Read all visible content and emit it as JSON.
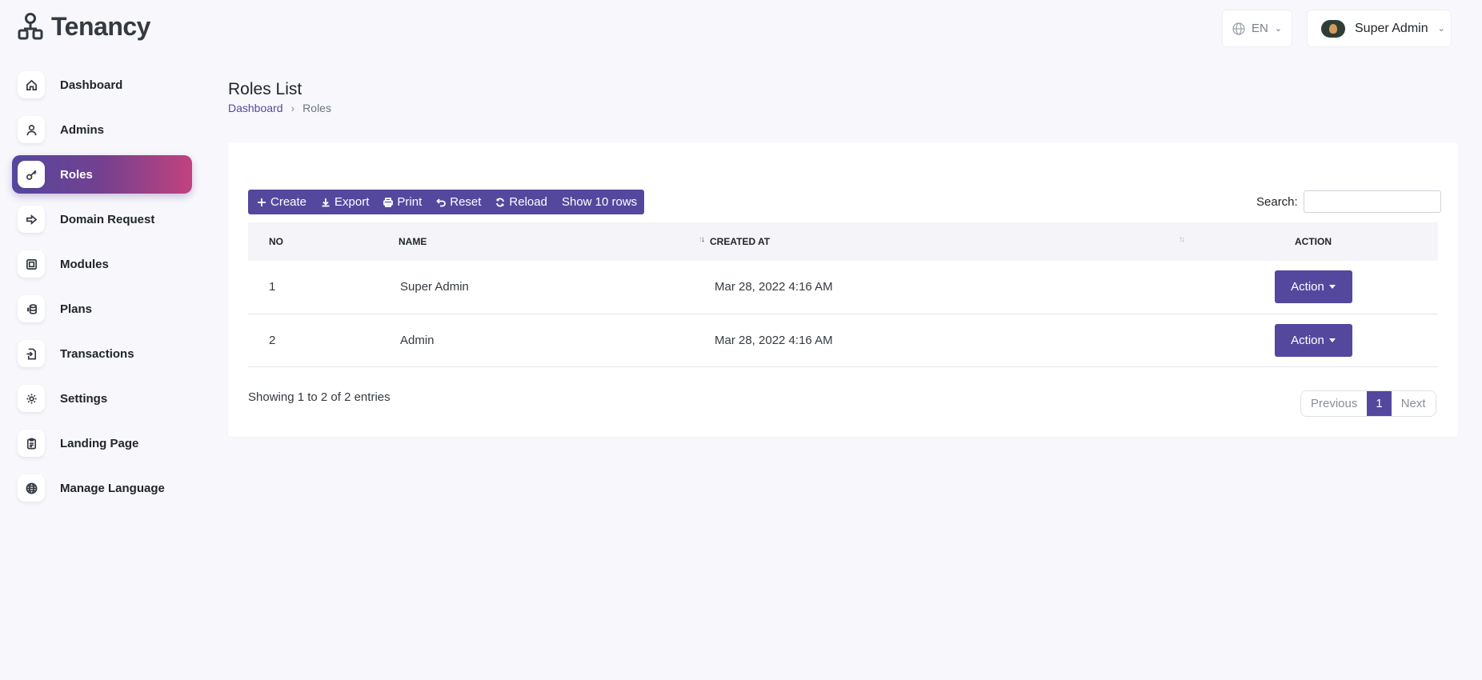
{
  "app": {
    "name": "Tenancy"
  },
  "header": {
    "language": "EN",
    "user_name": "Super Admin"
  },
  "sidebar": {
    "items": [
      {
        "label": "Dashboard",
        "icon": "home-icon"
      },
      {
        "label": "Admins",
        "icon": "user-icon"
      },
      {
        "label": "Roles",
        "icon": "key-icon",
        "active": true
      },
      {
        "label": "Domain Request",
        "icon": "arrow-right-icon"
      },
      {
        "label": "Modules",
        "icon": "cpu-icon"
      },
      {
        "label": "Plans",
        "icon": "coins-icon"
      },
      {
        "label": "Transactions",
        "icon": "file-transfer-icon"
      },
      {
        "label": "Settings",
        "icon": "gear-icon"
      },
      {
        "label": "Landing Page",
        "icon": "clipboard-icon"
      },
      {
        "label": "Manage Language",
        "icon": "globe-icon"
      }
    ]
  },
  "page": {
    "title": "Roles List",
    "breadcrumb": {
      "parent": "Dashboard",
      "current": "Roles"
    }
  },
  "toolbar": {
    "create": "Create",
    "export": "Export",
    "print": "Print",
    "reset": "Reset",
    "reload": "Reload",
    "show_rows": "Show 10 rows"
  },
  "search": {
    "label": "Search:",
    "value": ""
  },
  "table": {
    "columns": [
      "NO",
      "NAME",
      "CREATED AT",
      "ACTION"
    ],
    "rows": [
      {
        "no": "1",
        "name": "Super Admin",
        "created_at": "Mar 28, 2022 4:16 AM",
        "action": "Action"
      },
      {
        "no": "2",
        "name": "Admin",
        "created_at": "Mar 28, 2022 4:16 AM",
        "action": "Action"
      }
    ]
  },
  "footer": {
    "entries": "Showing 1 to 2 of 2 entries",
    "previous": "Previous",
    "page": "1",
    "next": "Next"
  },
  "colors": {
    "primary": "#54489e",
    "gradient_end": "#c2427e",
    "background": "#f8f8fc"
  }
}
